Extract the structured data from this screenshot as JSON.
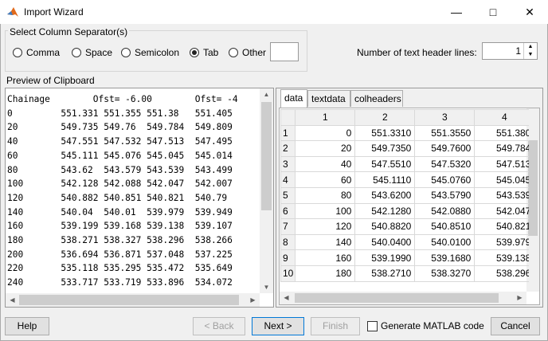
{
  "window": {
    "title": "Import Wizard"
  },
  "separator": {
    "legend": "Select Column Separator(s)",
    "options": [
      "Comma",
      "Space",
      "Semicolon",
      "Tab",
      "Other"
    ],
    "selected": "Tab",
    "other_value": ""
  },
  "header_lines": {
    "label": "Number of text header lines:",
    "value": "1"
  },
  "preview": {
    "label": "Preview of Clipboard",
    "lines": [
      "Chainage        Ofst= -6.00        Ofst= -4",
      "0         551.331 551.355 551.38   551.405",
      "20        549.735 549.76  549.784  549.809",
      "40        547.551 547.532 547.513  547.495",
      "60        545.111 545.076 545.045  545.014",
      "80        543.62  543.579 543.539  543.499",
      "100       542.128 542.088 542.047  542.007",
      "120       540.882 540.851 540.821  540.79",
      "140       540.04  540.01  539.979  539.949",
      "160       539.199 539.168 539.138  539.107",
      "180       538.271 538.327 538.296  538.266",
      "200       536.694 536.871 537.048  537.225",
      "220       535.118 535.295 535.472  535.649",
      "240       533.717 533.719 533.896  534.072"
    ]
  },
  "tabs": [
    "data",
    "textdata",
    "colheaders"
  ],
  "active_tab": "data",
  "table": {
    "columns": [
      "1",
      "2",
      "3",
      "4"
    ],
    "rows": [
      {
        "n": "1",
        "cells": [
          "0",
          "551.3310",
          "551.3550",
          "551.380"
        ]
      },
      {
        "n": "2",
        "cells": [
          "20",
          "549.7350",
          "549.7600",
          "549.784"
        ]
      },
      {
        "n": "3",
        "cells": [
          "40",
          "547.5510",
          "547.5320",
          "547.513"
        ]
      },
      {
        "n": "4",
        "cells": [
          "60",
          "545.1110",
          "545.0760",
          "545.045"
        ]
      },
      {
        "n": "5",
        "cells": [
          "80",
          "543.6200",
          "543.5790",
          "543.539"
        ]
      },
      {
        "n": "6",
        "cells": [
          "100",
          "542.1280",
          "542.0880",
          "542.047"
        ]
      },
      {
        "n": "7",
        "cells": [
          "120",
          "540.8820",
          "540.8510",
          "540.821"
        ]
      },
      {
        "n": "8",
        "cells": [
          "140",
          "540.0400",
          "540.0100",
          "539.979"
        ]
      },
      {
        "n": "9",
        "cells": [
          "160",
          "539.1990",
          "539.1680",
          "539.138"
        ]
      },
      {
        "n": "10",
        "cells": [
          "180",
          "538.2710",
          "538.3270",
          "538.296"
        ]
      }
    ]
  },
  "buttons": {
    "help": "Help",
    "back": "< Back",
    "next": "Next >",
    "finish": "Finish",
    "generate": "Generate MATLAB code",
    "cancel": "Cancel"
  },
  "colors": {
    "accent": "#0078d7",
    "matlab_orange": "#e16a1c"
  }
}
